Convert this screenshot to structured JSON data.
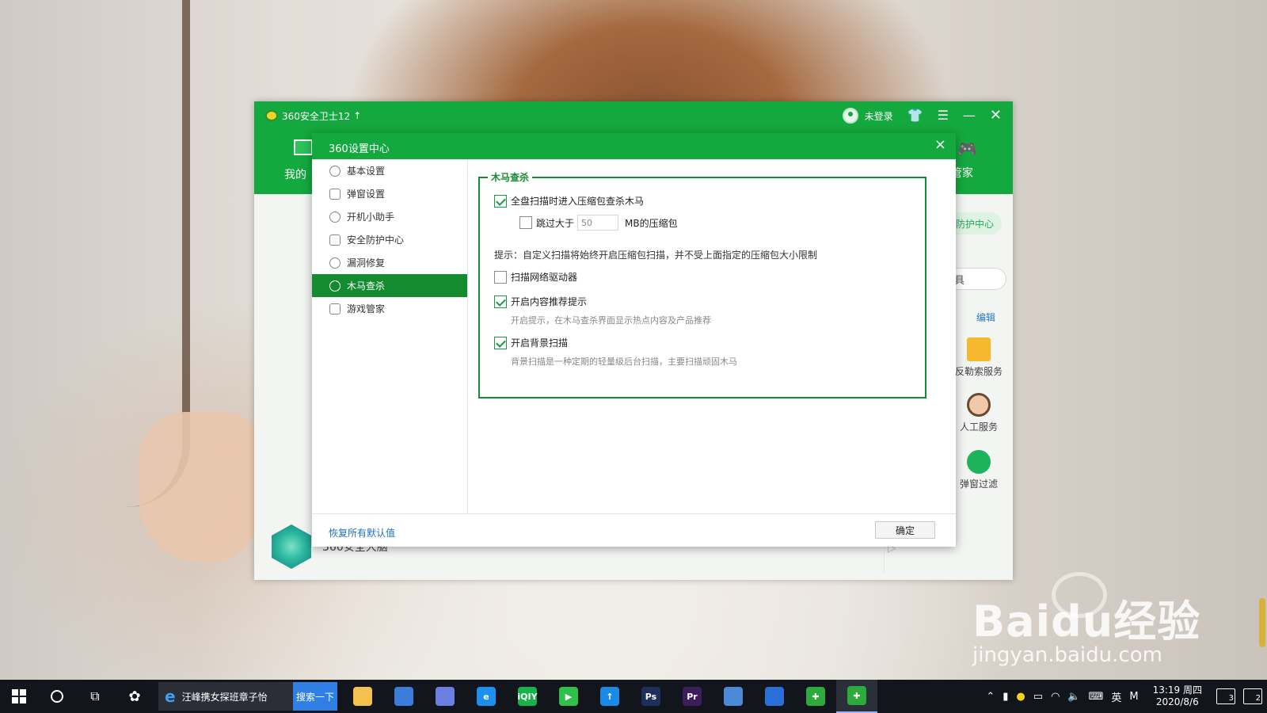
{
  "main_window": {
    "app_title": "360安全卫士12",
    "upgrade_arrow": "↑",
    "login_status": "未登录",
    "nav_mine_label": "我的",
    "nav_steward_label": "管家",
    "protect_center": "防护中心",
    "tool_search_partial": "具",
    "edit_label": "编辑",
    "services": {
      "ransom": "反勒索服务",
      "human": "人工服务",
      "popup": "弹窗过滤"
    },
    "brain_label": "360安全大脑"
  },
  "dialog": {
    "title": "360设置中心",
    "close": "×",
    "sidebar": [
      {
        "label": "基本设置",
        "icon": "gear-icon",
        "active": false
      },
      {
        "label": "弹窗设置",
        "icon": "window-icon",
        "active": false
      },
      {
        "label": "开机小助手",
        "icon": "clock-icon",
        "active": false
      },
      {
        "label": "安全防护中心",
        "icon": "shield-grid-icon",
        "active": false
      },
      {
        "label": "漏洞修复",
        "icon": "patch-icon",
        "active": false
      },
      {
        "label": "木马查杀",
        "icon": "trojan-icon",
        "active": true
      },
      {
        "label": "游戏管家",
        "icon": "gamepad-icon",
        "active": false
      }
    ],
    "group_title": "木马查杀",
    "options": {
      "scan_archives": {
        "label": "全盘扫描时进入压缩包查杀木马",
        "checked": true
      },
      "skip_larger": {
        "label_before": "跳过大于",
        "value": "50",
        "label_after": "MB的压缩包",
        "checked": false
      },
      "hint": "提示：自定义扫描将始终开启压缩包扫描，并不受上面指定的压缩包大小限制",
      "network_drives": {
        "label": "扫描网络驱动器",
        "checked": false
      },
      "content_recommend": {
        "label": "开启内容推荐提示",
        "checked": true,
        "desc": "开启提示，在木马查杀界面显示热点内容及产品推荐"
      },
      "background_scan": {
        "label": "开启背景扫描",
        "checked": true,
        "desc": "背景扫描是一种定期的轻量级后台扫描，主要扫描顽固木马"
      }
    },
    "footer": {
      "restore_defaults": "恢复所有默认值",
      "ok": "确定"
    }
  },
  "taskbar": {
    "ie_task_label": "汪峰携女探班章子怡",
    "search_button": "搜索一下",
    "apps": [
      {
        "name": "file-explorer-icon",
        "color": "#f2c14e",
        "text": ""
      },
      {
        "name": "store-icon",
        "color": "#3c7dd9",
        "text": ""
      },
      {
        "name": "feather-app-icon",
        "color": "#6b7fe0",
        "text": ""
      },
      {
        "name": "edge-icon",
        "color": "#1d8ff0",
        "text": "e"
      },
      {
        "name": "iqiyi-icon",
        "color": "#17b34a",
        "text": "iQIY"
      },
      {
        "name": "video-player-icon",
        "color": "#2fbf4a",
        "text": "▶"
      },
      {
        "name": "xunlei-icon",
        "color": "#1a8ae6",
        "text": "↑"
      },
      {
        "name": "photoshop-icon",
        "color": "#1f2f5c",
        "text": "Ps"
      },
      {
        "name": "premiere-icon",
        "color": "#3d1d5a",
        "text": "Pr"
      },
      {
        "name": "card-app-icon",
        "color": "#4c8ad8",
        "text": ""
      },
      {
        "name": "browser-icon",
        "color": "#2a6fd6",
        "text": ""
      },
      {
        "name": "360-guard-icon",
        "color": "#2caa3c",
        "text": "✚"
      },
      {
        "name": "360-active-icon",
        "color": "#2caa3c",
        "text": "✚"
      }
    ],
    "tray": {
      "ime": "英",
      "ime_mode": "M",
      "time": "13:19 周四",
      "date": "2020/8/6",
      "notif_count": "3",
      "msg_count": "2"
    }
  },
  "watermark": {
    "main": "Baidu经验",
    "sub": "jingyan.baidu.com"
  }
}
